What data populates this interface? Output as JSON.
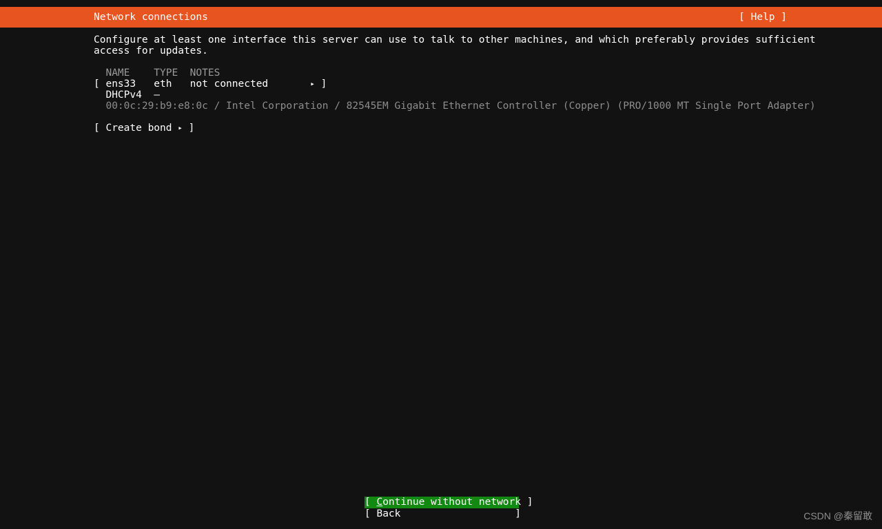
{
  "header": {
    "title": "Network connections",
    "help_label": "[ Help ]",
    "bar_color": "#e8541f",
    "text_color": "#ffffff"
  },
  "intro": {
    "line1": "Configure at least one interface this server can use to talk to other machines, and which preferably provides sufficient",
    "line2": "access for updates."
  },
  "table": {
    "headers": "  NAME    TYPE  NOTES",
    "rows": [
      {
        "text": "[ ens33   eth   not connected       ",
        "arrow": "▸",
        "suffix": " ]"
      },
      {
        "text": "  DHCPv4  –",
        "arrow": "",
        "suffix": ""
      },
      {
        "text": "  00:0c:29:b9:e8:0c / Intel Corporation / 82545EM Gigabit Ethernet Controller (Copper) (PRO/1000 MT Single Port Adapter)",
        "arrow": "",
        "suffix": ""
      }
    ]
  },
  "create_bond": {
    "prefix": "[ Create bond ",
    "arrow": "▸",
    "suffix": " ]"
  },
  "buttons": [
    {
      "name": "continue-without-network",
      "prefix": "[ ",
      "accel": "C",
      "rest": "ontinue without network ]",
      "selected": true,
      "highlight_color": "#128a12"
    },
    {
      "name": "back",
      "prefix": "[ ",
      "accel": "",
      "rest": "Back                   ]",
      "selected": false,
      "highlight_color": ""
    }
  ],
  "watermark": {
    "text": "CSDN @秦留敢"
  }
}
